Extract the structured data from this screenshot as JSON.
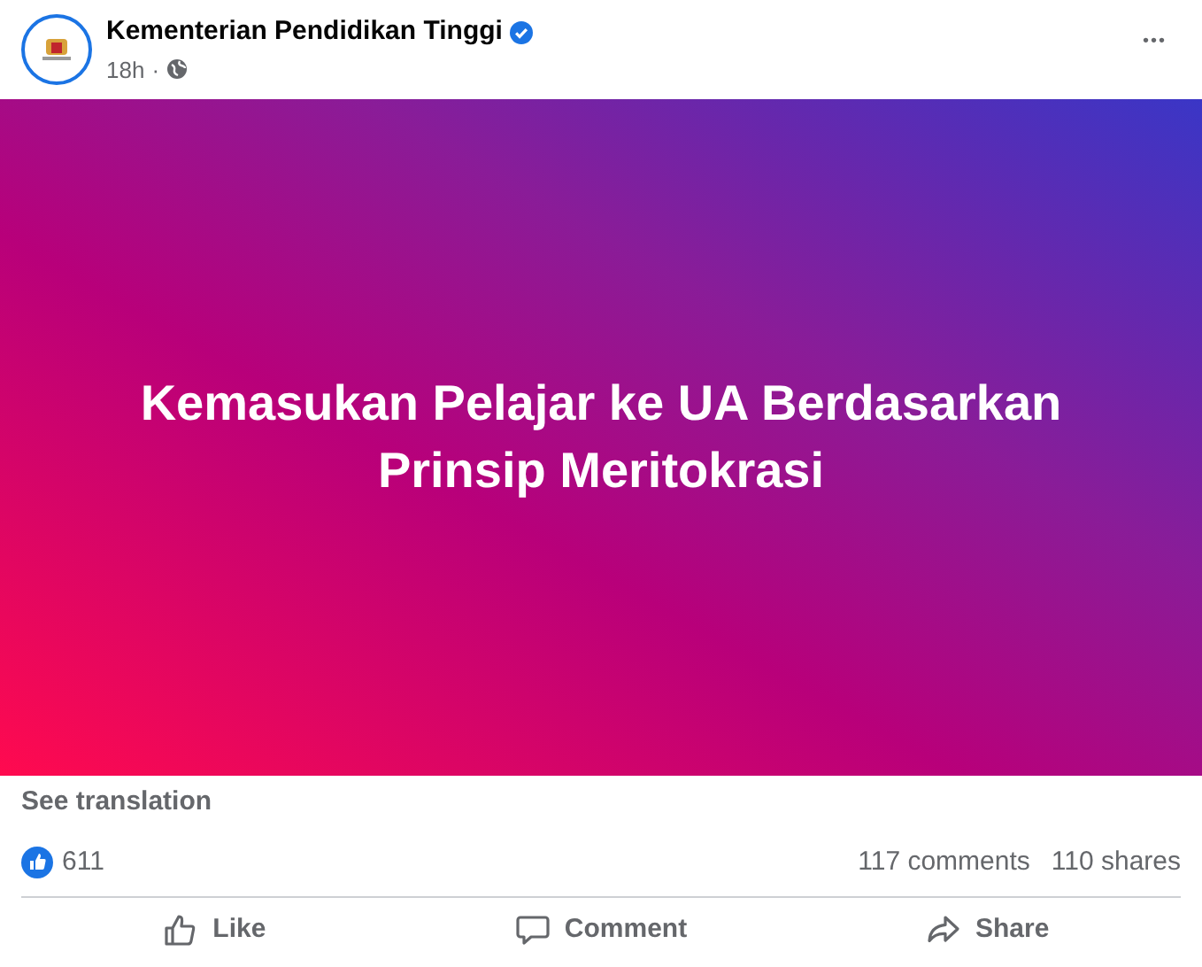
{
  "post": {
    "author": "Kementerian Pendidikan Tinggi",
    "verified": true,
    "time": "18h",
    "separator": "·",
    "menu": "•••"
  },
  "banner": {
    "headline": "Kemasukan Pelajar ke UA Berdasarkan Prinsip Meritokrasi"
  },
  "see_translation": "See translation",
  "stats": {
    "reactions": "611",
    "comments": "117 comments",
    "shares": "110 shares"
  },
  "actions": [
    {
      "kind": "like",
      "label": "Like"
    },
    {
      "kind": "comment",
      "label": "Comment"
    },
    {
      "kind": "share",
      "label": "Share"
    }
  ]
}
